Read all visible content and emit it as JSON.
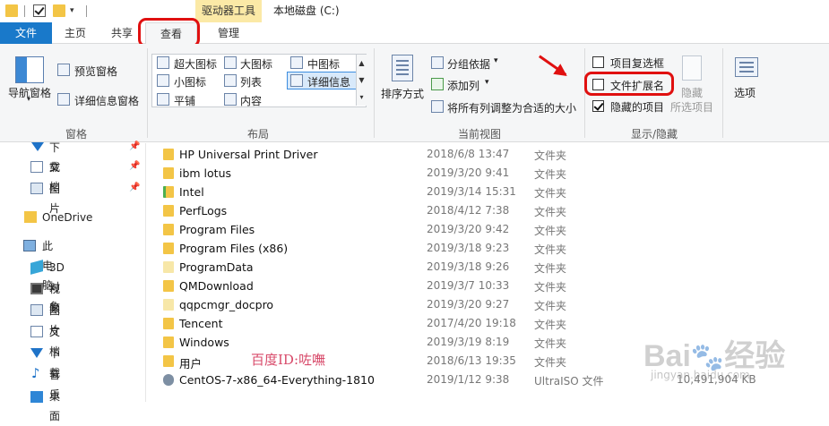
{
  "titlebar": {
    "tool_context": "驱动器工具",
    "window_title": "本地磁盘 (C:)"
  },
  "tabs": {
    "file": "文件",
    "home": "主页",
    "share": "共享",
    "view": "查看",
    "manage": "管理"
  },
  "ribbon": {
    "panes": {
      "nav_pane": "导航窗格",
      "preview_pane": "预览窗格",
      "details_pane": "详细信息窗格",
      "group": "窗格"
    },
    "layout": {
      "extra_large_icons": "超大图标",
      "large_icons": "大图标",
      "medium_icons": "中图标",
      "small_icons": "小图标",
      "list": "列表",
      "details": "详细信息",
      "tiles": "平铺",
      "content": "内容",
      "group": "布局"
    },
    "current_view": {
      "sort_by": "排序方式",
      "group_by": "分组依据",
      "add_columns": "添加列",
      "size_all_columns": "将所有列调整为合适的大小",
      "group": "当前视图"
    },
    "show_hide": {
      "item_check_boxes": "项目复选框",
      "file_name_extensions": "文件扩展名",
      "hidden_items": "隐藏的项目",
      "hide_label": "隐藏",
      "hide_selected_items": "所选项目",
      "group": "显示/隐藏"
    },
    "options": "选项"
  },
  "nav_pane": {
    "items": [
      {
        "label": "下载",
        "icon": "download-arrow-icon",
        "pinned": true
      },
      {
        "label": "文档",
        "icon": "document-icon",
        "pinned": true
      },
      {
        "label": "图片",
        "icon": "pictures-icon",
        "pinned": true
      },
      {
        "label": "OneDrive",
        "icon": "onedrive-folder-icon",
        "pinned": false
      },
      {
        "label": "此电脑",
        "icon": "this-pc-icon",
        "pinned": false
      },
      {
        "label": "3D 对象",
        "icon": "cube-3d-icon",
        "pinned": false
      },
      {
        "label": "视频",
        "icon": "video-icon",
        "pinned": false
      },
      {
        "label": "图片",
        "icon": "pictures-icon",
        "pinned": false
      },
      {
        "label": "文档",
        "icon": "document-icon",
        "pinned": false
      },
      {
        "label": "下载",
        "icon": "download-arrow-icon",
        "pinned": false
      },
      {
        "label": "音乐",
        "icon": "music-note-icon",
        "pinned": false
      },
      {
        "label": "桌面",
        "icon": "desktop-icon",
        "pinned": false
      }
    ]
  },
  "files": [
    {
      "name": "HP Universal Print Driver",
      "date": "2018/6/8 13:47",
      "type": "文件夹",
      "size": ""
    },
    {
      "name": "ibm lotus",
      "date": "2019/3/20 9:41",
      "type": "文件夹",
      "size": ""
    },
    {
      "name": "Intel",
      "date": "2019/3/14 15:31",
      "type": "文件夹",
      "size": ""
    },
    {
      "name": "PerfLogs",
      "date": "2018/4/12 7:38",
      "type": "文件夹",
      "size": ""
    },
    {
      "name": "Program Files",
      "date": "2019/3/20 9:42",
      "type": "文件夹",
      "size": ""
    },
    {
      "name": "Program Files (x86)",
      "date": "2019/3/18 9:23",
      "type": "文件夹",
      "size": ""
    },
    {
      "name": "ProgramData",
      "date": "2019/3/18 9:26",
      "type": "文件夹",
      "size": ""
    },
    {
      "name": "QMDownload",
      "date": "2019/3/7 10:33",
      "type": "文件夹",
      "size": ""
    },
    {
      "name": "qqpcmgr_docpro",
      "date": "2019/3/20 9:27",
      "type": "文件夹",
      "size": ""
    },
    {
      "name": "Tencent",
      "date": "2017/4/20 19:18",
      "type": "文件夹",
      "size": ""
    },
    {
      "name": "Windows",
      "date": "2019/3/19 8:19",
      "type": "文件夹",
      "size": ""
    },
    {
      "name": "用户",
      "date": "2018/6/13 19:35",
      "type": "文件夹",
      "size": ""
    },
    {
      "name": "CentOS-7-x86_64-Everything-1810",
      "date": "2019/1/12 9:38",
      "type": "UltraISO 文件",
      "size": "10,491,904 KB"
    }
  ],
  "watermark": {
    "id_text": "百度ID:咗嘸",
    "brand": "Bai du 经验",
    "url": "jingyan.baidu.com"
  },
  "colors": {
    "accent": "#1979ca",
    "highlight": "#e01010",
    "folder": "#f3c546",
    "context_tab": "#fbe9a6"
  }
}
